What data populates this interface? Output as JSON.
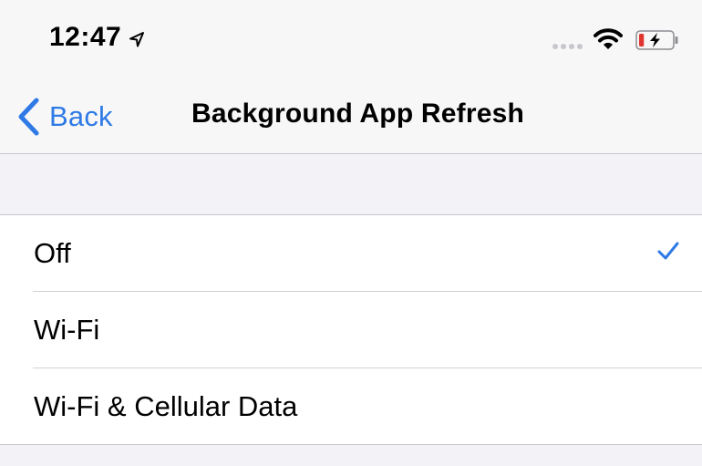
{
  "status_bar": {
    "time": "12:47",
    "icons": [
      "location-arrow-icon",
      "signal-dots-icon",
      "wifi-icon",
      "battery-charging-icon"
    ],
    "battery_level_fraction": 0.15,
    "battery_color": "#e0362f"
  },
  "nav": {
    "back_label": "Back",
    "title": "Background App Refresh",
    "accent_color": "#2f7ae5"
  },
  "options": [
    {
      "label": "Off",
      "selected": true
    },
    {
      "label": "Wi-Fi",
      "selected": false
    },
    {
      "label": "Wi-Fi & Cellular Data",
      "selected": false
    }
  ]
}
